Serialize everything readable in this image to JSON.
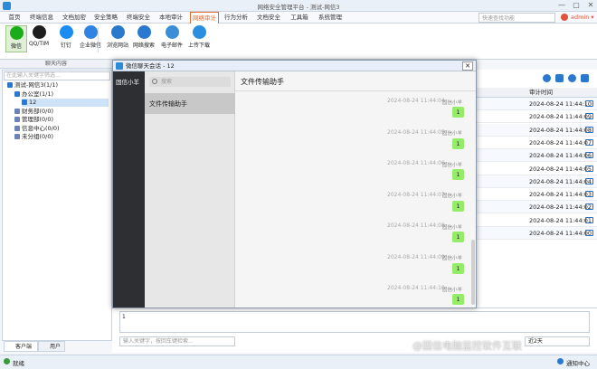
{
  "window": {
    "title": "网络安全管理平台 - 测试-网信3",
    "minimize": "—",
    "maximize": "▢",
    "close": "✕"
  },
  "menu": [
    "首页",
    "终端信息",
    "文档加密",
    "安全策略",
    "终端安全",
    "本地审计",
    "网络审计",
    "行为分析",
    "文档安全",
    "工具箱",
    "系统管理"
  ],
  "menu_active_index": 6,
  "search": {
    "placeholder": "快速查找功能"
  },
  "user": {
    "name": "admin ▾"
  },
  "toolbar": [
    {
      "label": "微信",
      "icon": "wechat-icon",
      "color": "#1aad19"
    },
    {
      "label": "QQ/TIM",
      "icon": "qq-icon",
      "color": "#1e1e1e"
    },
    {
      "label": "钉钉",
      "icon": "dingtalk-icon",
      "color": "#1b8cf2"
    },
    {
      "label": "企业微信",
      "icon": "wecom-icon",
      "color": "#2f83e3"
    },
    {
      "label": "浏览网站",
      "icon": "globe-icon",
      "color": "#2a79cf"
    },
    {
      "label": "网络搜索",
      "icon": "search-globe-icon",
      "color": "#2a79cf"
    },
    {
      "label": "电子邮件",
      "icon": "mail-icon",
      "color": "#3a8ed8"
    },
    {
      "label": "上传下载",
      "icon": "cloud-icon",
      "color": "#2a8fe0"
    }
  ],
  "toolbar_group_label": "聊天内容",
  "tree_search_placeholder": "在此输入关键字筛选...",
  "tree": [
    {
      "label": "测试-网信3(1/1)",
      "indent": 0,
      "icon": "#2a79cf"
    },
    {
      "label": "办公室(1/1)",
      "indent": 1,
      "icon": "#2a79cf"
    },
    {
      "label": "12",
      "indent": 2,
      "icon": "#2a79cf",
      "selected": true
    },
    {
      "label": "财务部(0/0)",
      "indent": 1,
      "icon": "#6b83b5"
    },
    {
      "label": "管理部(0/0)",
      "indent": 1,
      "icon": "#6b83b5"
    },
    {
      "label": "信息中心(0/0)",
      "indent": 1,
      "icon": "#6b83b5"
    },
    {
      "label": "未分组(0/0)",
      "indent": 1,
      "icon": "#6b83b5"
    }
  ],
  "bottom_tabs": [
    "客户端",
    "用户"
  ],
  "right": {
    "column_header": "审计时间",
    "rows": [
      "2024-08-24 11:44:10",
      "2024-08-24 11:44:09",
      "2024-08-24 11:44:08",
      "2024-08-24 11:44:07",
      "2024-08-24 11:44:06",
      "2024-08-24 11:44:05",
      "2024-08-24 11:44:04",
      "2024-08-24 11:44:03",
      "2024-08-24 11:44:02",
      "2024-08-24 11:44:01",
      "2024-08-24 11:44:00"
    ]
  },
  "message_box_value": "1",
  "keyword_placeholder": "输入关键字，按回车键检索...",
  "sort_select": "近2天",
  "watermark": "@固信电脑监控软件互联",
  "status": {
    "left": "就绪",
    "right": "通知中心"
  },
  "dialog": {
    "title": "微信聊天会话 - 12",
    "close": "✕",
    "side_label": "固信小羊",
    "search_placeholder": "搜索",
    "contact": "文件传输助手",
    "chat_title": "文件传输助手",
    "messages": [
      {
        "time": "2024-08-24 11:44:04",
        "sender": "固信小羊",
        "text": "1"
      },
      {
        "time": "2024-08-24 11:44:05",
        "sender": "固信小羊",
        "text": "1"
      },
      {
        "time": "2024-08-24 11:44:06",
        "sender": "固信小羊",
        "text": "1"
      },
      {
        "time": "2024-08-24 11:44:07",
        "sender": "固信小羊",
        "text": "1"
      },
      {
        "time": "2024-08-24 11:44:08",
        "sender": "固信小羊",
        "text": "1"
      },
      {
        "time": "2024-08-24 11:44:09",
        "sender": "固信小羊",
        "text": "1"
      },
      {
        "time": "2024-08-24 11:44:10",
        "sender": "固信小羊",
        "text": "1"
      }
    ]
  }
}
